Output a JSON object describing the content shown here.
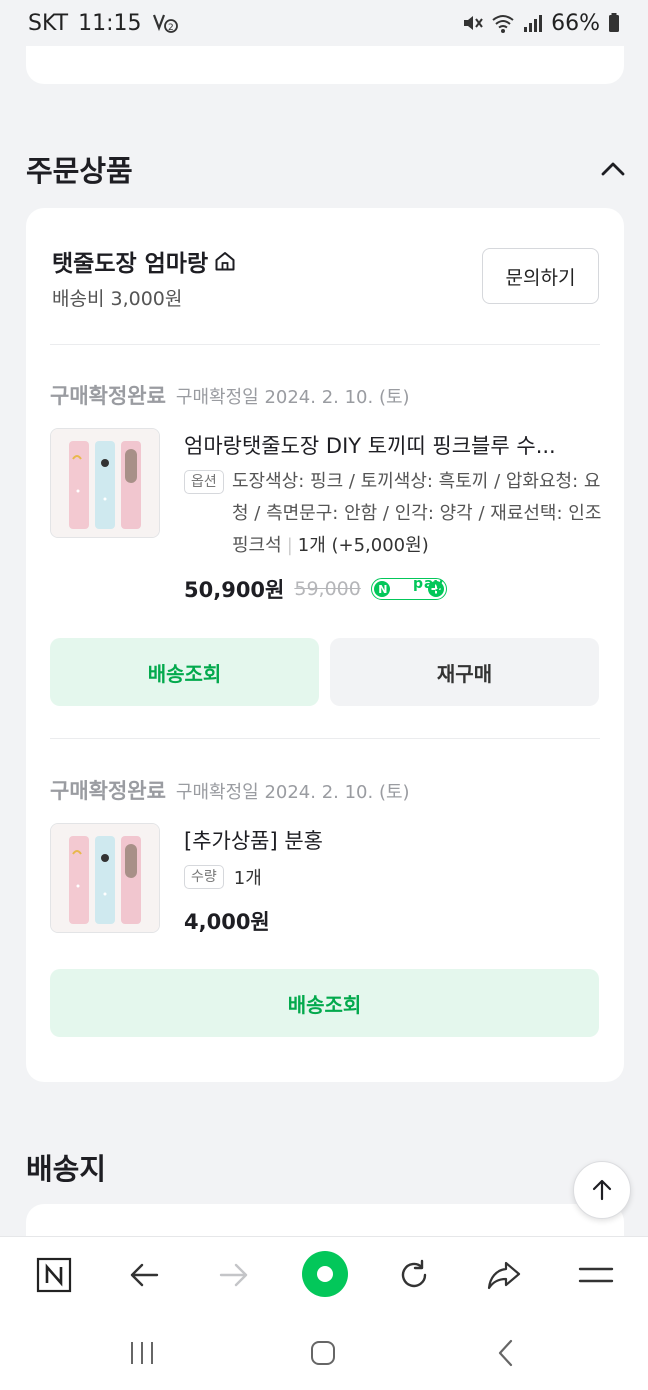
{
  "status_bar": {
    "carrier": "SKT",
    "time": "11:15",
    "battery": "66%"
  },
  "section_order": {
    "title": "주문상품"
  },
  "seller": {
    "name": "탯줄도장 엄마랑",
    "shipping_fee": "배송비 3,000원",
    "inquiry_label": "문의하기"
  },
  "items": [
    {
      "status": "구매확정완료",
      "date": "구매확정일 2024. 2. 10. (토)",
      "name": "엄마랑탯줄도장 DIY 토끼띠 핑크블루 수...",
      "tag": "옵션",
      "options": "도장색상: 핑크 / 토끼색상: 흑토끼 / 압화요청: 요청 / 측면문구: 안함 / 인각: 양각 / 재료선택: 인조 핑크석",
      "quantity": "1개 (+5,000원)",
      "price": "50,900원",
      "original_price": "59,000",
      "npay_label": "pay",
      "track_label": "배송조회",
      "rebuy_label": "재구매"
    },
    {
      "status": "구매확정완료",
      "date": "구매확정일 2024. 2. 10. (토)",
      "name": "[추가상품] 분홍",
      "tag": "수량",
      "quantity": "1개",
      "price": "4,000원",
      "track_label": "배송조회"
    }
  ],
  "section_shipping": {
    "title": "배송지"
  },
  "colors": {
    "accent_green": "#03a94d",
    "light_green": "#e4f7ed",
    "background": "#f2f3f5"
  },
  "icons": {
    "seller_home": "home-icon",
    "collapse": "chevron-up-icon",
    "scroll_top": "arrow-up-icon",
    "toolbar": [
      "naver-n-icon",
      "back-arrow-icon",
      "forward-arrow-icon",
      "green-dot-icon",
      "refresh-icon",
      "share-icon",
      "menu-icon"
    ],
    "nav": [
      "recent-apps-icon",
      "home-button-icon",
      "back-chevron-icon"
    ]
  }
}
